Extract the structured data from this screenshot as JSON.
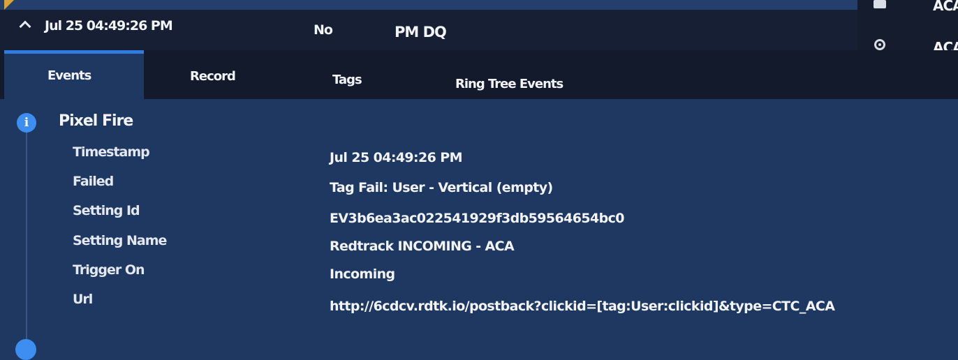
{
  "call": {
    "timestamp": "Jul 25 04:49:26 PM",
    "flag": "No",
    "campaign": "PM DQ"
  },
  "right_panel": {
    "label_one": "ACA",
    "label_two": "ACA"
  },
  "tabs": [
    {
      "label": "Events",
      "active": true
    },
    {
      "label": "Record",
      "active": false
    },
    {
      "label": "Tags",
      "active": false
    },
    {
      "label": "Ring Tree Events",
      "active": false
    }
  ],
  "event": {
    "icon": "info-icon",
    "title": "Pixel Fire",
    "fields": [
      {
        "label": "Timestamp",
        "value": "Jul 25 04:49:26 PM"
      },
      {
        "label": "Failed",
        "value": "Tag Fail: User - Vertical (empty)"
      },
      {
        "label": "Setting Id",
        "value": "EV3b6ea3ac022541929f3db59564654bc0"
      },
      {
        "label": "Setting Name",
        "value": "Redtrack INCOMING - ACA"
      },
      {
        "label": "Trigger On",
        "value": "Incoming"
      },
      {
        "label": "Url",
        "value": "http://6cdcv.rdtk.io/postback?clickid=[tag:User:clickid]&type=CTC_ACA"
      }
    ]
  },
  "colors": {
    "background": "#1f3862",
    "header_bg": "#161f33",
    "accent": "#2f7be0",
    "info_icon": "#3d8ef0",
    "corner_flag": "#d9a43a"
  }
}
